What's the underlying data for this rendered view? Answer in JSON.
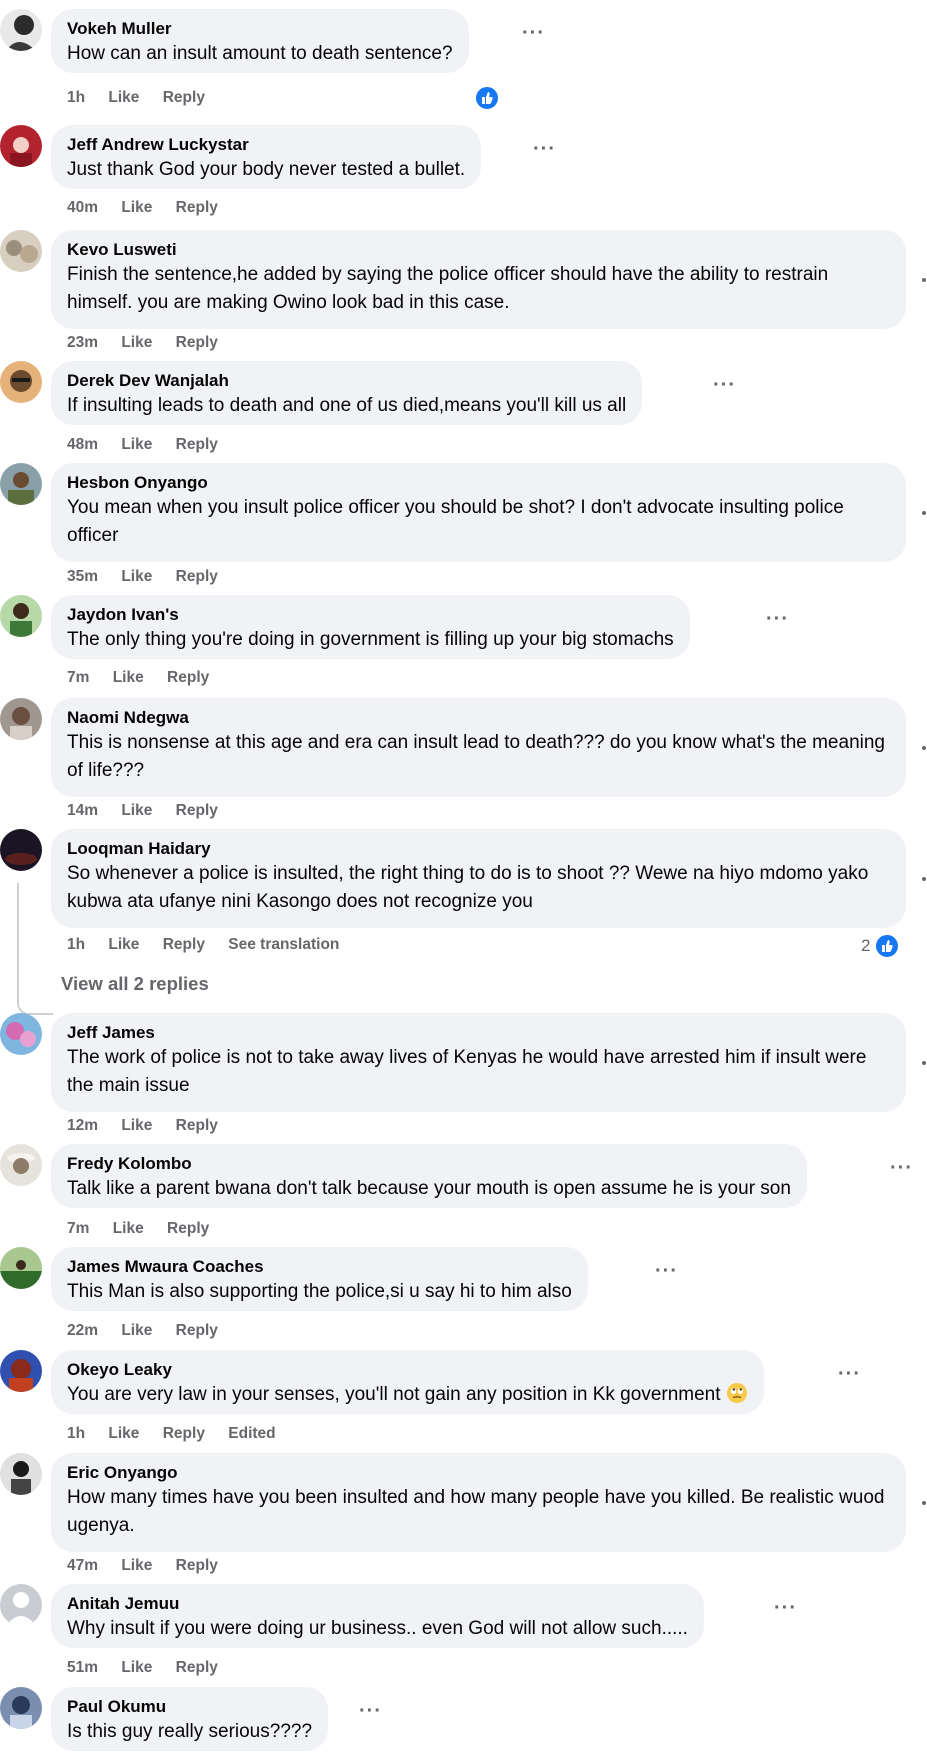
{
  "comments": [
    {
      "author": "Vokeh Muller",
      "text": "How can an insult amount to death sentence?",
      "time": "1h",
      "like": "Like",
      "reply": "Reply",
      "avatar_colors": [
        "#2b2b2b",
        "#e8e8e8"
      ]
    },
    {
      "author": "Jeff Andrew Luckystar",
      "text": "Just thank God your body never tested a bullet.",
      "time": "40m",
      "like": "Like",
      "reply": "Reply",
      "avatar_colors": [
        "#b3232d",
        "#f2d0c8"
      ]
    },
    {
      "author": "Kevo Lusweti",
      "text": "Finish the sentence,he added by saying the police officer should have the ability to restrain himself. you are making Owino look bad in this case.",
      "time": "23m",
      "like": "Like",
      "reply": "Reply",
      "avatar_colors": [
        "#9a8f7a",
        "#d9cfc0"
      ]
    },
    {
      "author": "Derek Dev Wanjalah",
      "text": "If insulting leads to death and one of us died,means you'll kill us all",
      "time": "48m",
      "like": "Like",
      "reply": "Reply",
      "avatar_colors": [
        "#6b4a2e",
        "#e5b27a"
      ]
    },
    {
      "author": "Hesbon Onyango",
      "text": "You mean when you insult police officer you should be shot? I don't advocate insulting police officer",
      "time": "35m",
      "like": "Like",
      "reply": "Reply",
      "avatar_colors": [
        "#8aa0a8",
        "#5b6e3e"
      ]
    },
    {
      "author": "Jaydon Ivan's",
      "text": "The only thing you're doing in government is filling up your big stomachs",
      "time": "7m",
      "like": "Like",
      "reply": "Reply",
      "avatar_colors": [
        "#3d7a3a",
        "#b7d9a8"
      ]
    },
    {
      "author": "Naomi Ndegwa",
      "text": "This is nonsense at this age and era can insult lead to death??? do you know what's the meaning of life???",
      "time": "14m",
      "like": "Like",
      "reply": "Reply",
      "avatar_colors": [
        "#a09890",
        "#6a5040"
      ]
    },
    {
      "author": "Looqman Haidary",
      "text": "So whenever a police is insulted, the right thing to do is to shoot ?? Wewe na hiyo mdomo yako kubwa ata ufanye nini Kasongo does not recognize you",
      "time": "1h",
      "like": "Like",
      "reply": "Reply",
      "see_translation": "See translation",
      "reaction_count": "2",
      "view_replies": "View all 2 replies",
      "avatar_colors": [
        "#1a1424",
        "#5a2020"
      ]
    },
    {
      "author": "Jeff James",
      "text": "The work of police is not to take away lives of Kenyas he would have arrested him if insult were the main issue",
      "time": "12m",
      "like": "Like",
      "reply": "Reply",
      "avatar_colors": [
        "#d46ab0",
        "#7fb6e0"
      ]
    },
    {
      "author": "Fredy Kolombo",
      "text": "Talk like a parent bwana don't talk because your mouth is open assume he is your son",
      "time": "7m",
      "like": "Like",
      "reply": "Reply",
      "avatar_colors": [
        "#e6e2dc",
        "#8c7b66"
      ]
    },
    {
      "author": "James Mwaura Coaches",
      "text": "This Man is also supporting the police,si u say hi to him also",
      "time": "22m",
      "like": "Like",
      "reply": "Reply",
      "avatar_colors": [
        "#2f6b2a",
        "#a8c890"
      ]
    },
    {
      "author": "Okeyo Leaky",
      "text": "You are very law in your senses, you'll not gain any position in Kk government",
      "time": "1h",
      "like": "Like",
      "reply": "Reply",
      "edited": "Edited",
      "avatar_colors": [
        "#8a2a1a",
        "#3050b0"
      ]
    },
    {
      "author": "Eric Onyango",
      "text": "How many times have you been insulted and how many people have you killed. Be realistic wuod ugenya.",
      "time": "47m",
      "like": "Like",
      "reply": "Reply",
      "avatar_colors": [
        "#e0e0e0",
        "#1a1a1a"
      ]
    },
    {
      "author": "Anitah Jemuu",
      "text": "Why insult if you were doing ur business.. even God will not allow such.....",
      "time": "51m",
      "like": "Like",
      "reply": "Reply",
      "avatar_colors": [
        "#c9ccd1",
        "#ffffff"
      ]
    },
    {
      "author": "Paul Okumu",
      "text": "Is this guy really serious????",
      "avatar_colors": [
        "#7a8fb0",
        "#2a3a5a"
      ]
    }
  ],
  "more_label": "···",
  "colors": {
    "bubble": "#f0f2f5",
    "meta": "#65676b",
    "like_blue": "#1877f2"
  },
  "icons": {
    "like_badge": "thumbs-up-icon",
    "more": "more-options-icon",
    "emoji": "rolling-eyes-emoji-icon"
  }
}
